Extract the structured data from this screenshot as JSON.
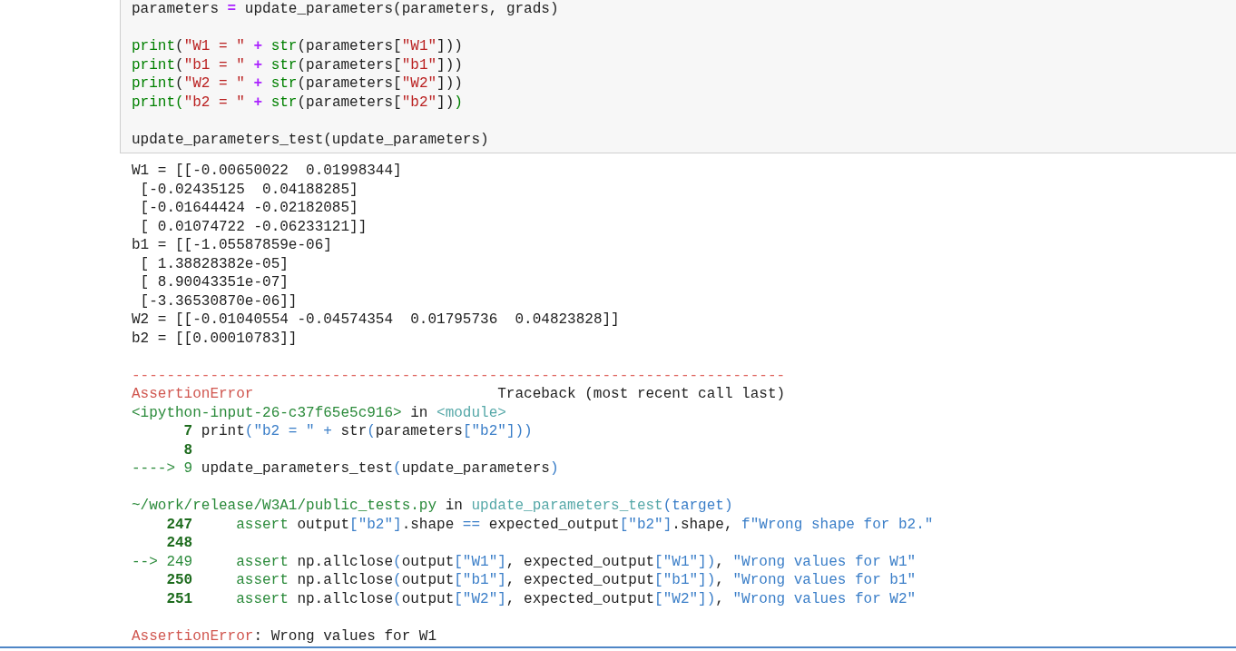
{
  "input_cell": {
    "lines": [
      {
        "spans": [
          {
            "kind": "plain",
            "text": "parameters"
          },
          {
            "kind": "op",
            "text": " = "
          },
          {
            "kind": "plain",
            "text": "update_parameters(parameters, grads)"
          }
        ]
      },
      {
        "blank_before": true,
        "spans": [
          {
            "kind": "builtin",
            "text": "print"
          },
          {
            "kind": "plain",
            "text": "("
          },
          {
            "kind": "string",
            "text": "\"W1 = \""
          },
          {
            "kind": "op",
            "text": " + "
          },
          {
            "kind": "builtin",
            "text": "str"
          },
          {
            "kind": "plain",
            "text": "(parameters["
          },
          {
            "kind": "string",
            "text": "\"W1\""
          },
          {
            "kind": "plain",
            "text": "]))"
          }
        ]
      },
      {
        "spans": [
          {
            "kind": "builtin",
            "text": "print"
          },
          {
            "kind": "plain",
            "text": "("
          },
          {
            "kind": "string",
            "text": "\"b1 = \""
          },
          {
            "kind": "op",
            "text": " + "
          },
          {
            "kind": "builtin",
            "text": "str"
          },
          {
            "kind": "plain",
            "text": "(parameters["
          },
          {
            "kind": "string",
            "text": "\"b1\""
          },
          {
            "kind": "plain",
            "text": "]))"
          }
        ]
      },
      {
        "spans": [
          {
            "kind": "builtin",
            "text": "print"
          },
          {
            "kind": "plain",
            "text": "("
          },
          {
            "kind": "string",
            "text": "\"W2 = \""
          },
          {
            "kind": "op",
            "text": " + "
          },
          {
            "kind": "builtin",
            "text": "str"
          },
          {
            "kind": "plain",
            "text": "(parameters["
          },
          {
            "kind": "string",
            "text": "\"W2\""
          },
          {
            "kind": "plain",
            "text": "]))"
          }
        ]
      },
      {
        "spans": [
          {
            "kind": "builtin",
            "text": "print"
          },
          {
            "kind": "builtin",
            "text": "("
          },
          {
            "kind": "string",
            "text": "\"b2 = \""
          },
          {
            "kind": "op",
            "text": " + "
          },
          {
            "kind": "builtin",
            "text": "str"
          },
          {
            "kind": "plain",
            "text": "(parameters["
          },
          {
            "kind": "string",
            "text": "\"b2\""
          },
          {
            "kind": "plain",
            "text": "])"
          },
          {
            "kind": "builtin",
            "text": ")"
          }
        ]
      },
      {
        "blank_before": true,
        "spans": [
          {
            "kind": "plain",
            "text": "update_parameters_test(update_parameters)"
          }
        ]
      }
    ]
  },
  "output": {
    "lines": [
      {
        "spans": [
          {
            "kind": "plain",
            "text": "W1 = [[-0.00650022  0.01998344]"
          }
        ]
      },
      {
        "spans": [
          {
            "kind": "plain",
            "text": " [-0.02435125  0.04188285]"
          }
        ]
      },
      {
        "spans": [
          {
            "kind": "plain",
            "text": " [-0.01644424 -0.02182085]"
          }
        ]
      },
      {
        "spans": [
          {
            "kind": "plain",
            "text": " [ 0.01074722 -0.06233121]]"
          }
        ]
      },
      {
        "spans": [
          {
            "kind": "plain",
            "text": "b1 = [[-1.05587859e-06]"
          }
        ]
      },
      {
        "spans": [
          {
            "kind": "plain",
            "text": " [ 1.38828382e-05]"
          }
        ]
      },
      {
        "spans": [
          {
            "kind": "plain",
            "text": " [ 8.90043351e-07]"
          }
        ]
      },
      {
        "spans": [
          {
            "kind": "plain",
            "text": " [-3.36530870e-06]]"
          }
        ]
      },
      {
        "spans": [
          {
            "kind": "plain",
            "text": "W2 = [[-0.01040554 -0.04574354  0.01795736  0.04823828]]"
          }
        ]
      },
      {
        "spans": [
          {
            "kind": "plain",
            "text": "b2 = [[0.00010783]]"
          }
        ]
      },
      {
        "kind": "rule",
        "blank_before": true,
        "text": "---------------------------------------------------------------------------"
      },
      {
        "kind": "header",
        "error": "AssertionError",
        "title": "Traceback (most recent call last)"
      },
      {
        "spans": [
          {
            "kind": "path",
            "text": "<ipython-input-26-c37f65e5c916>"
          },
          {
            "kind": "plain",
            "text": " in "
          },
          {
            "kind": "func",
            "text": "<module>"
          }
        ]
      },
      {
        "kind": "code",
        "lineno": "7",
        "spans": [
          {
            "kind": "plain",
            "text": "print"
          },
          {
            "kind": "punct",
            "text": "(\"b2 = \" + "
          },
          {
            "kind": "plain",
            "text": "str"
          },
          {
            "kind": "punct",
            "text": "("
          },
          {
            "kind": "plain",
            "text": "parameters"
          },
          {
            "kind": "punct",
            "text": "[\"b2\"]))"
          }
        ]
      },
      {
        "kind": "code",
        "lineno": "8"
      },
      {
        "kind": "code",
        "marker": "---->",
        "lineno": "9",
        "spans": [
          {
            "kind": "plain",
            "text": "update_parameters_test"
          },
          {
            "kind": "punct",
            "text": "("
          },
          {
            "kind": "plain",
            "text": "update_parameters"
          },
          {
            "kind": "punct",
            "text": ")"
          }
        ]
      },
      {
        "blank_before": true,
        "spans": [
          {
            "kind": "path",
            "text": "~/work/release/W3A1/public_tests.py"
          },
          {
            "kind": "plain",
            "text": " in "
          },
          {
            "kind": "func",
            "text": "update_parameters_test"
          },
          {
            "kind": "punct",
            "text": "(target)"
          }
        ]
      },
      {
        "kind": "code",
        "lineno": "247",
        "spans": [
          {
            "kind": "kw",
            "text": "    assert"
          },
          {
            "kind": "plain",
            "text": " output"
          },
          {
            "kind": "punct",
            "text": "[\"b2\"]"
          },
          {
            "kind": "plain",
            "text": ".shape "
          },
          {
            "kind": "punct",
            "text": "=="
          },
          {
            "kind": "plain",
            "text": " expected_output"
          },
          {
            "kind": "punct",
            "text": "[\"b2\"]"
          },
          {
            "kind": "plain",
            "text": ".shape, "
          },
          {
            "kind": "punct",
            "text": "f\"Wrong shape for b2.\""
          }
        ]
      },
      {
        "kind": "code",
        "lineno": "248"
      },
      {
        "kind": "code",
        "marker": "-->",
        "lineno": "249",
        "spans": [
          {
            "kind": "kw",
            "text": "    assert"
          },
          {
            "kind": "plain",
            "text": " np.allclose"
          },
          {
            "kind": "punct",
            "text": "("
          },
          {
            "kind": "plain",
            "text": "output"
          },
          {
            "kind": "punct",
            "text": "[\"W1\"]"
          },
          {
            "kind": "plain",
            "text": ", expected_output"
          },
          {
            "kind": "punct",
            "text": "[\"W1\"])"
          },
          {
            "kind": "plain",
            "text": ", "
          },
          {
            "kind": "punct",
            "text": "\"Wrong values for W1\""
          }
        ]
      },
      {
        "kind": "code",
        "lineno": "250",
        "spans": [
          {
            "kind": "kw",
            "text": "    assert"
          },
          {
            "kind": "plain",
            "text": " np.allclose"
          },
          {
            "kind": "punct",
            "text": "("
          },
          {
            "kind": "plain",
            "text": "output"
          },
          {
            "kind": "punct",
            "text": "[\"b1\"]"
          },
          {
            "kind": "plain",
            "text": ", expected_output"
          },
          {
            "kind": "punct",
            "text": "[\"b1\"])"
          },
          {
            "kind": "plain",
            "text": ", "
          },
          {
            "kind": "punct",
            "text": "\"Wrong values for b1\""
          }
        ]
      },
      {
        "kind": "code",
        "lineno": "251",
        "spans": [
          {
            "kind": "kw",
            "text": "    assert"
          },
          {
            "kind": "plain",
            "text": " np.allclose"
          },
          {
            "kind": "punct",
            "text": "("
          },
          {
            "kind": "plain",
            "text": "output"
          },
          {
            "kind": "punct",
            "text": "[\"W2\"]"
          },
          {
            "kind": "plain",
            "text": ", expected_output"
          },
          {
            "kind": "punct",
            "text": "[\"W2\"])"
          },
          {
            "kind": "plain",
            "text": ", "
          },
          {
            "kind": "punct",
            "text": "\"Wrong values for W2\""
          }
        ]
      },
      {
        "blank_before": true,
        "spans": [
          {
            "kind": "err",
            "text": "AssertionError"
          },
          {
            "kind": "plain",
            "text": ": Wrong values for W1"
          }
        ]
      }
    ]
  }
}
